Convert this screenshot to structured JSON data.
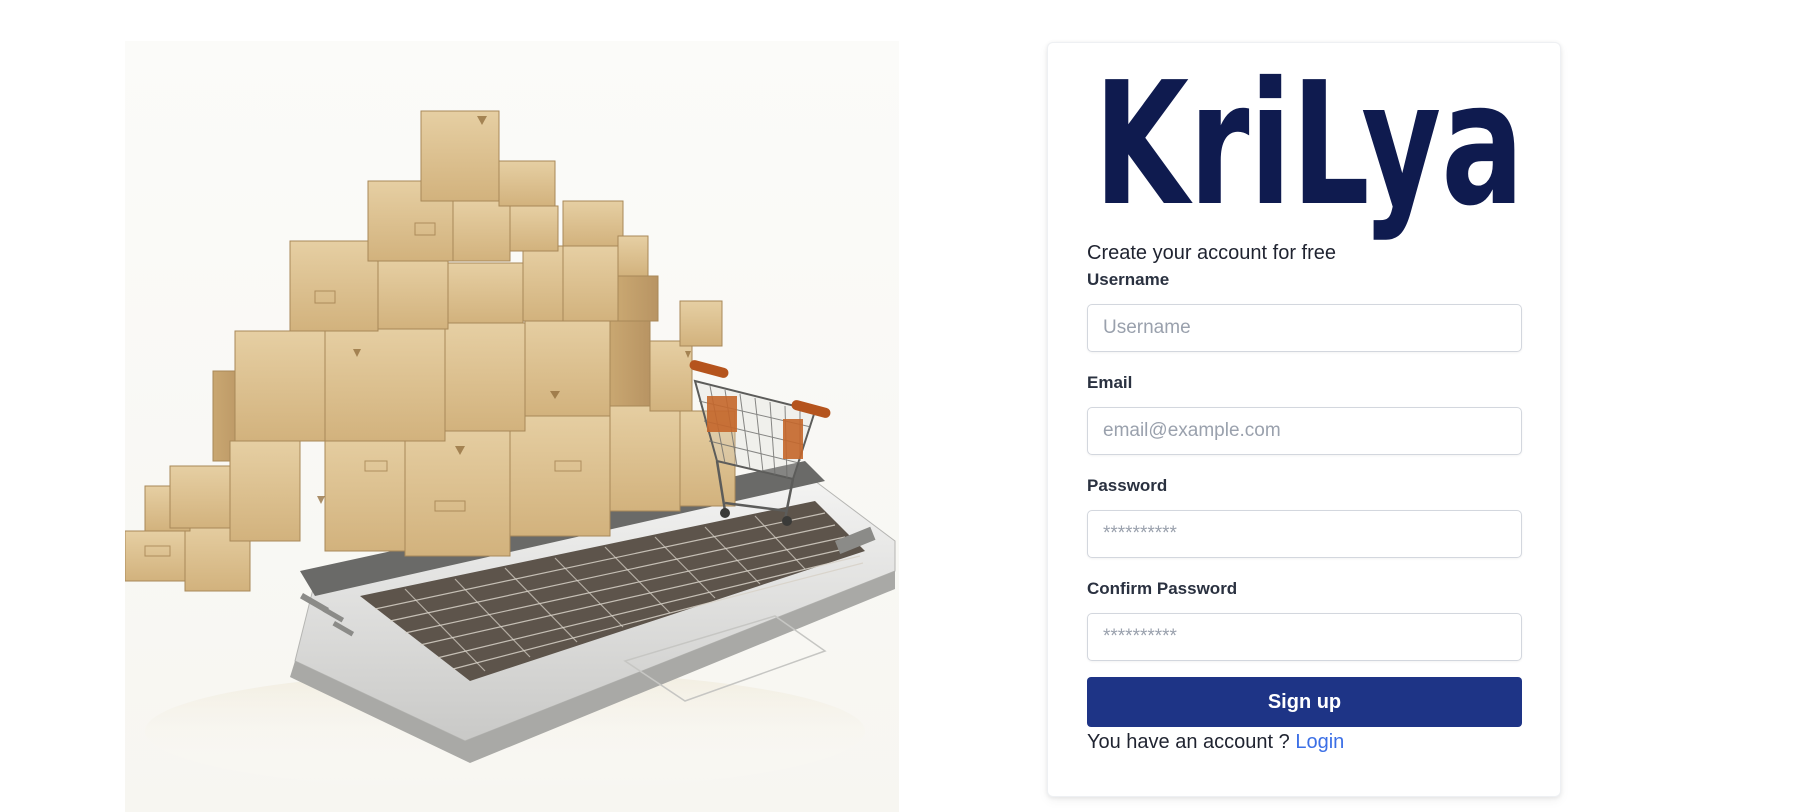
{
  "brand": {
    "logo_text": "KriLya",
    "color": "#0f1b4f"
  },
  "form": {
    "tagline": "Create your account for free",
    "fields": {
      "username": {
        "label": "Username",
        "placeholder": "Username"
      },
      "email": {
        "label": "Email",
        "placeholder": "email@example.com"
      },
      "password": {
        "label": "Password",
        "placeholder": "**********"
      },
      "confirm_password": {
        "label": "Confirm Password",
        "placeholder": "**********"
      }
    },
    "submit_label": "Sign up",
    "account_prompt": "You have an account ?",
    "login_label": "Login"
  },
  "colors": {
    "primary_button": "#1e3486",
    "link": "#3b6fe6"
  },
  "hero": {
    "subject": "cardboard boxes, laptop and shopping cart illustration"
  }
}
